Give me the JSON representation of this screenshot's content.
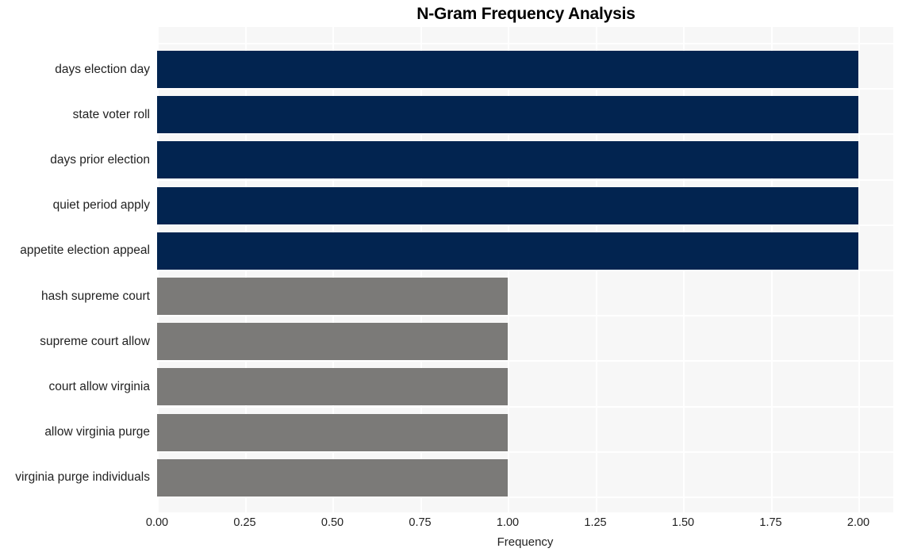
{
  "chart_data": {
    "type": "bar",
    "orientation": "horizontal",
    "title": "N-Gram Frequency Analysis",
    "xlabel": "Frequency",
    "ylabel": "",
    "categories": [
      "days election day",
      "state voter roll",
      "days prior election",
      "quiet period apply",
      "appetite election appeal",
      "hash supreme court",
      "supreme court allow",
      "court allow virginia",
      "allow virginia purge",
      "virginia purge individuals"
    ],
    "values": [
      2,
      2,
      2,
      2,
      2,
      1,
      1,
      1,
      1,
      1
    ],
    "bar_colors": [
      "#022450",
      "#022450",
      "#022450",
      "#022450",
      "#022450",
      "#7b7a78",
      "#7b7a78",
      "#7b7a78",
      "#7b7a78",
      "#7b7a78"
    ],
    "xlim": [
      0,
      2.0
    ],
    "xticks": [
      0.0,
      0.25,
      0.5,
      0.75,
      1.0,
      1.25,
      1.5,
      1.75,
      2.0
    ],
    "xticklabels": [
      "0.00",
      "0.25",
      "0.50",
      "0.75",
      "1.00",
      "1.25",
      "1.50",
      "1.75",
      "2.00"
    ],
    "grid": true,
    "legend": null,
    "colors": {
      "primary": "#022450",
      "secondary": "#7b7a78",
      "plot_background": "#f7f7f7",
      "figure_background": "#ffffff",
      "gridline": "#ffffff",
      "text": "#222222",
      "title_text": "#000000"
    }
  }
}
